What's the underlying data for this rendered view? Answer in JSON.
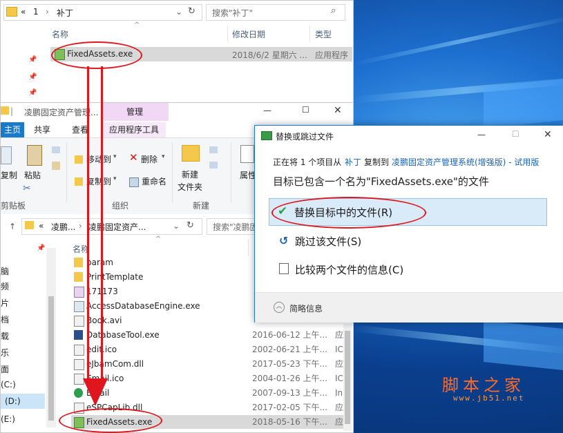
{
  "win1": {
    "nav_back": "«",
    "crumb1": "1",
    "crumb_arrow": "›",
    "crumb2": "补丁",
    "search_placeholder": "搜索\"补丁\"",
    "col_name": "名称",
    "col_date": "修改日期",
    "col_type": "类型",
    "file_name": "FixedAssets.exe",
    "file_date": "2018/6/2 星期六 ...",
    "file_type": "应用程序"
  },
  "win2": {
    "title": "凌鹏固定资产管理...",
    "context_tab": "管理",
    "minimize": "—",
    "maximize": "☐",
    "close": "✕",
    "tabs": [
      "主页",
      "共享",
      "查看",
      "应用程序工具"
    ],
    "ribbon": {
      "copy": "复制",
      "paste": "粘贴",
      "clipboard_group": "剪贴板",
      "move_to": "移动到",
      "copy_to": "复制到",
      "delete": "删除",
      "rename": "重命名",
      "organize_group": "组织",
      "new_folder_line1": "新建",
      "new_folder_line2": "文件夹",
      "new_group": "新建",
      "properties": "属性"
    },
    "crumb1": "凌鹏...",
    "crumb2": "凌鹏固定资产...",
    "search_placeholder": "搜索\"凌鹏固...",
    "col_name": "名称",
    "nav_items": [
      "脑",
      "频",
      "片",
      "档",
      "载",
      "乐",
      "面",
      "(C:)",
      "(D:)",
      "(E:)"
    ],
    "files": [
      {
        "name": "param",
        "date": "",
        "type": ""
      },
      {
        "name": "PrintTemplate",
        "date": "",
        "type": ""
      },
      {
        "name": "171173",
        "date": "",
        "type": ""
      },
      {
        "name": "AccessDatabaseEngine.exe",
        "date": "",
        "type": ""
      },
      {
        "name": "Book.avi",
        "date": "",
        "type": ""
      },
      {
        "name": "DatabaseTool.exe",
        "date": "2016-06-12 上午...",
        "type": "应"
      },
      {
        "name": "edit.ico",
        "date": "2002-06-21 上午...",
        "type": "IC"
      },
      {
        "name": "eJbamCom.dll",
        "date": "2017-05-23 下午...",
        "type": "应"
      },
      {
        "name": "Email.ico",
        "date": "2004-01-26 上午...",
        "type": "IC"
      },
      {
        "name": "Email",
        "date": "2007-09-13 上午...",
        "type": "In"
      },
      {
        "name": "eSPCapLib.dll",
        "date": "2017-02-05 下午...",
        "type": "应"
      },
      {
        "name": "FixedAssets.exe",
        "date": "2018-05-16 下午...",
        "type": "应"
      }
    ]
  },
  "dialog": {
    "title": "替换或跳过文件",
    "minimize": "—",
    "maximize": "☐",
    "close": "✕",
    "info_prefix": "正在将 1 个项目从",
    "source": "补丁",
    "info_mid": "复制到",
    "dest": "凌鹏固定资产管理系统(增强版) - 试用版",
    "heading": "目标已包含一个名为\"FixedAssets.exe\"的文件",
    "opt_replace": "替换目标中的文件(R)",
    "opt_skip": "跳过该文件(S)",
    "opt_compare": "比较两个文件的信息(C)",
    "details": "简略信息"
  },
  "watermark": {
    "line1": "脚本之家",
    "line2": "www.jb51.net"
  },
  "colors": {
    "accent": "#1979ca",
    "annotation": "#e0161e",
    "context_tab": "#f1d9f5"
  }
}
